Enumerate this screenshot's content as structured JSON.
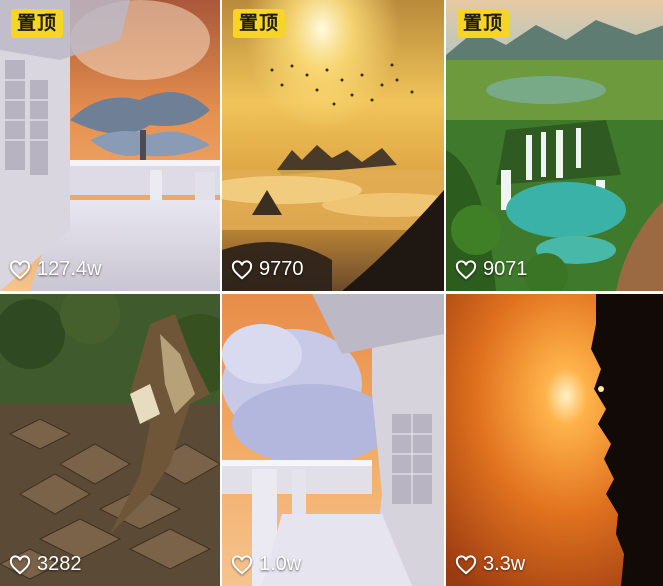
{
  "feed": {
    "pinned_label": "置顶",
    "items": [
      {
        "likes": "127.4w",
        "pinned": true
      },
      {
        "likes": "9770",
        "pinned": true
      },
      {
        "likes": "9071",
        "pinned": true
      },
      {
        "likes": "3282",
        "pinned": false
      },
      {
        "likes": "1.0w",
        "pinned": false
      },
      {
        "likes": "3.3w",
        "pinned": false
      }
    ]
  },
  "icons": {
    "like": "heart-outline-icon"
  },
  "colors": {
    "pin_badge": "#f7d524",
    "text": "#ffffff"
  }
}
